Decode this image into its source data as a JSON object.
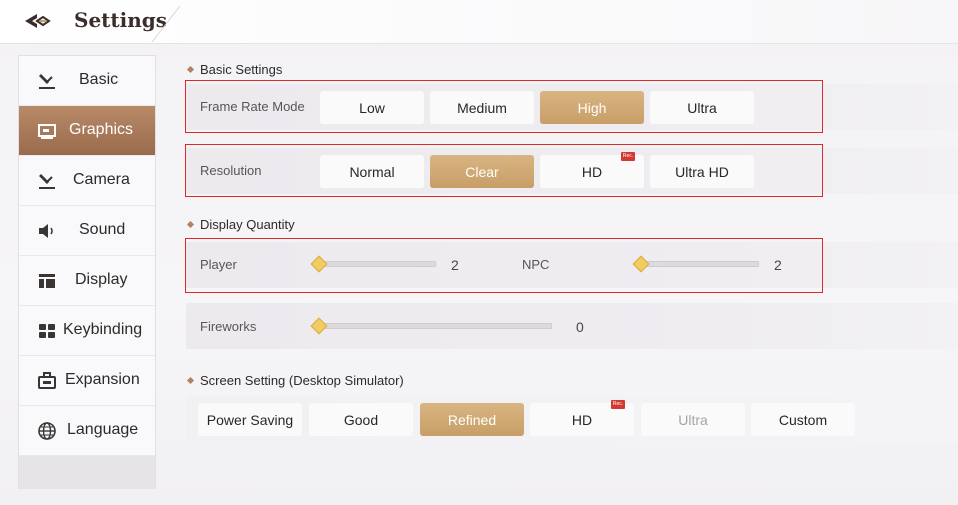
{
  "header": {
    "title": "Settings",
    "back_icon": "back-arrow-icon"
  },
  "sidebar": {
    "items": [
      {
        "label": "Basic",
        "icon": "gavel-icon",
        "active": false
      },
      {
        "label": "Graphics",
        "icon": "monitor-icon",
        "active": true
      },
      {
        "label": "Camera",
        "icon": "camera-gavel-icon",
        "active": false
      },
      {
        "label": "Sound",
        "icon": "speaker-icon",
        "active": false
      },
      {
        "label": "Display",
        "icon": "layout-icon",
        "active": false
      },
      {
        "label": "Keybinding",
        "icon": "grid-icon",
        "active": false
      },
      {
        "label": "Expansion",
        "icon": "briefcase-icon",
        "active": false
      },
      {
        "label": "Language",
        "icon": "globe-icon",
        "active": false
      }
    ]
  },
  "basic_settings": {
    "title": "Basic Settings",
    "frame_rate": {
      "label": "Frame Rate Mode",
      "options": [
        "Low",
        "Medium",
        "High",
        "Ultra"
      ],
      "selected": "High"
    },
    "resolution": {
      "label": "Resolution",
      "options": [
        "Normal",
        "Clear",
        "HD",
        "Ultra HD"
      ],
      "selected": "Clear",
      "rec_badge": "Rec."
    }
  },
  "display_quantity": {
    "title": "Display Quantity",
    "player": {
      "label": "Player",
      "value": "2"
    },
    "npc": {
      "label": "NPC",
      "value": "2"
    },
    "fireworks": {
      "label": "Fireworks",
      "value": "0"
    }
  },
  "screen_setting": {
    "title": "Screen Setting (Desktop Simulator)",
    "options": [
      "Power Saving",
      "Good",
      "Refined",
      "HD",
      "Ultra",
      "Custom"
    ],
    "selected": "Refined",
    "disabled": "Ultra",
    "rec_badge": "Rec."
  },
  "colors": {
    "accent_gold": "#c89e67",
    "sidebar_active": "#9a6b4c",
    "highlight_red": "#e0282a"
  }
}
